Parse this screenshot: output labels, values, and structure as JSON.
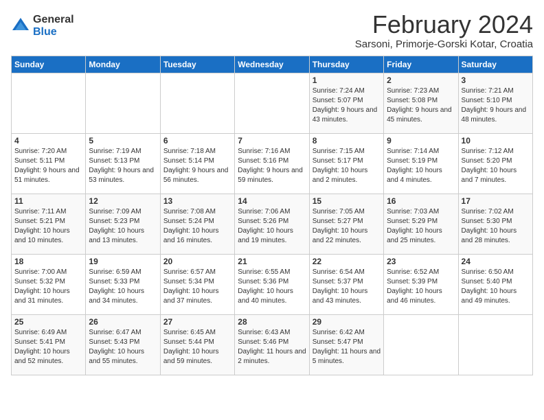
{
  "logo": {
    "general": "General",
    "blue": "Blue"
  },
  "title": "February 2024",
  "subtitle": "Sarsoni, Primorje-Gorski Kotar, Croatia",
  "days_of_week": [
    "Sunday",
    "Monday",
    "Tuesday",
    "Wednesday",
    "Thursday",
    "Friday",
    "Saturday"
  ],
  "weeks": [
    [
      {
        "day": "",
        "info": ""
      },
      {
        "day": "",
        "info": ""
      },
      {
        "day": "",
        "info": ""
      },
      {
        "day": "",
        "info": ""
      },
      {
        "day": "1",
        "info": "Sunrise: 7:24 AM\nSunset: 5:07 PM\nDaylight: 9 hours and 43 minutes."
      },
      {
        "day": "2",
        "info": "Sunrise: 7:23 AM\nSunset: 5:08 PM\nDaylight: 9 hours and 45 minutes."
      },
      {
        "day": "3",
        "info": "Sunrise: 7:21 AM\nSunset: 5:10 PM\nDaylight: 9 hours and 48 minutes."
      }
    ],
    [
      {
        "day": "4",
        "info": "Sunrise: 7:20 AM\nSunset: 5:11 PM\nDaylight: 9 hours and 51 minutes."
      },
      {
        "day": "5",
        "info": "Sunrise: 7:19 AM\nSunset: 5:13 PM\nDaylight: 9 hours and 53 minutes."
      },
      {
        "day": "6",
        "info": "Sunrise: 7:18 AM\nSunset: 5:14 PM\nDaylight: 9 hours and 56 minutes."
      },
      {
        "day": "7",
        "info": "Sunrise: 7:16 AM\nSunset: 5:16 PM\nDaylight: 9 hours and 59 minutes."
      },
      {
        "day": "8",
        "info": "Sunrise: 7:15 AM\nSunset: 5:17 PM\nDaylight: 10 hours and 2 minutes."
      },
      {
        "day": "9",
        "info": "Sunrise: 7:14 AM\nSunset: 5:19 PM\nDaylight: 10 hours and 4 minutes."
      },
      {
        "day": "10",
        "info": "Sunrise: 7:12 AM\nSunset: 5:20 PM\nDaylight: 10 hours and 7 minutes."
      }
    ],
    [
      {
        "day": "11",
        "info": "Sunrise: 7:11 AM\nSunset: 5:21 PM\nDaylight: 10 hours and 10 minutes."
      },
      {
        "day": "12",
        "info": "Sunrise: 7:09 AM\nSunset: 5:23 PM\nDaylight: 10 hours and 13 minutes."
      },
      {
        "day": "13",
        "info": "Sunrise: 7:08 AM\nSunset: 5:24 PM\nDaylight: 10 hours and 16 minutes."
      },
      {
        "day": "14",
        "info": "Sunrise: 7:06 AM\nSunset: 5:26 PM\nDaylight: 10 hours and 19 minutes."
      },
      {
        "day": "15",
        "info": "Sunrise: 7:05 AM\nSunset: 5:27 PM\nDaylight: 10 hours and 22 minutes."
      },
      {
        "day": "16",
        "info": "Sunrise: 7:03 AM\nSunset: 5:29 PM\nDaylight: 10 hours and 25 minutes."
      },
      {
        "day": "17",
        "info": "Sunrise: 7:02 AM\nSunset: 5:30 PM\nDaylight: 10 hours and 28 minutes."
      }
    ],
    [
      {
        "day": "18",
        "info": "Sunrise: 7:00 AM\nSunset: 5:32 PM\nDaylight: 10 hours and 31 minutes."
      },
      {
        "day": "19",
        "info": "Sunrise: 6:59 AM\nSunset: 5:33 PM\nDaylight: 10 hours and 34 minutes."
      },
      {
        "day": "20",
        "info": "Sunrise: 6:57 AM\nSunset: 5:34 PM\nDaylight: 10 hours and 37 minutes."
      },
      {
        "day": "21",
        "info": "Sunrise: 6:55 AM\nSunset: 5:36 PM\nDaylight: 10 hours and 40 minutes."
      },
      {
        "day": "22",
        "info": "Sunrise: 6:54 AM\nSunset: 5:37 PM\nDaylight: 10 hours and 43 minutes."
      },
      {
        "day": "23",
        "info": "Sunrise: 6:52 AM\nSunset: 5:39 PM\nDaylight: 10 hours and 46 minutes."
      },
      {
        "day": "24",
        "info": "Sunrise: 6:50 AM\nSunset: 5:40 PM\nDaylight: 10 hours and 49 minutes."
      }
    ],
    [
      {
        "day": "25",
        "info": "Sunrise: 6:49 AM\nSunset: 5:41 PM\nDaylight: 10 hours and 52 minutes."
      },
      {
        "day": "26",
        "info": "Sunrise: 6:47 AM\nSunset: 5:43 PM\nDaylight: 10 hours and 55 minutes."
      },
      {
        "day": "27",
        "info": "Sunrise: 6:45 AM\nSunset: 5:44 PM\nDaylight: 10 hours and 59 minutes."
      },
      {
        "day": "28",
        "info": "Sunrise: 6:43 AM\nSunset: 5:46 PM\nDaylight: 11 hours and 2 minutes."
      },
      {
        "day": "29",
        "info": "Sunrise: 6:42 AM\nSunset: 5:47 PM\nDaylight: 11 hours and 5 minutes."
      },
      {
        "day": "",
        "info": ""
      },
      {
        "day": "",
        "info": ""
      }
    ]
  ]
}
